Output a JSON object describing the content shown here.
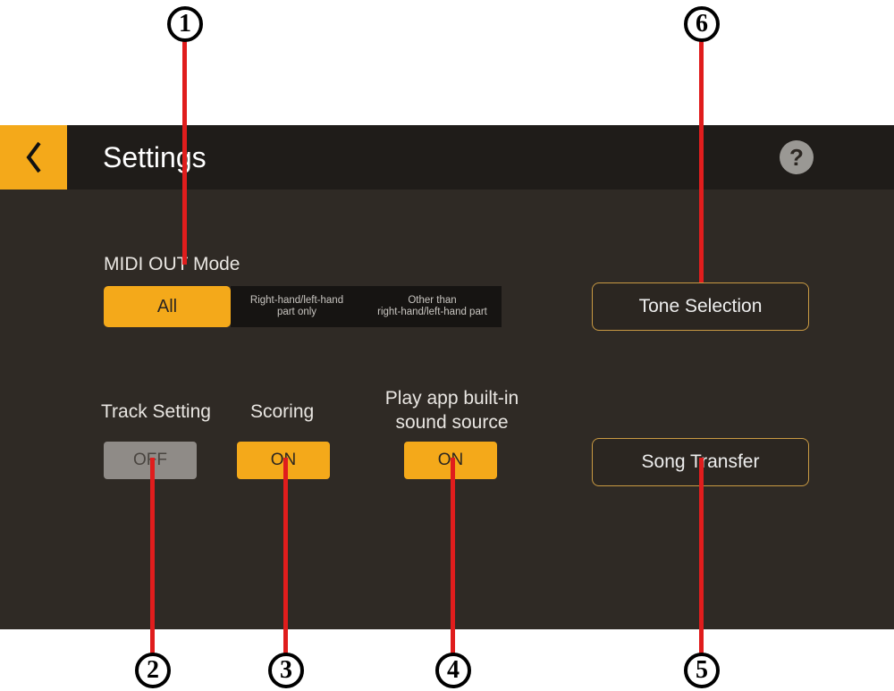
{
  "header": {
    "title": "Settings",
    "help_label": "?"
  },
  "midi_out": {
    "label": "MIDI OUT Mode",
    "options": {
      "all": "All",
      "parts_only": "Right-hand/left-hand\npart only",
      "other_than": "Other than\nright-hand/left-hand part"
    }
  },
  "buttons": {
    "tone_selection": "Tone Selection",
    "song_transfer": "Song Transfer"
  },
  "toggles": {
    "track_setting": {
      "label": "Track Setting",
      "value": "OFF"
    },
    "scoring": {
      "label": "Scoring",
      "value": "ON"
    },
    "play_builtin": {
      "label": "Play app built-in\nsound source",
      "value": "ON"
    }
  },
  "callouts": {
    "c1": "1",
    "c2": "2",
    "c3": "3",
    "c4": "4",
    "c5": "5",
    "c6": "6"
  }
}
